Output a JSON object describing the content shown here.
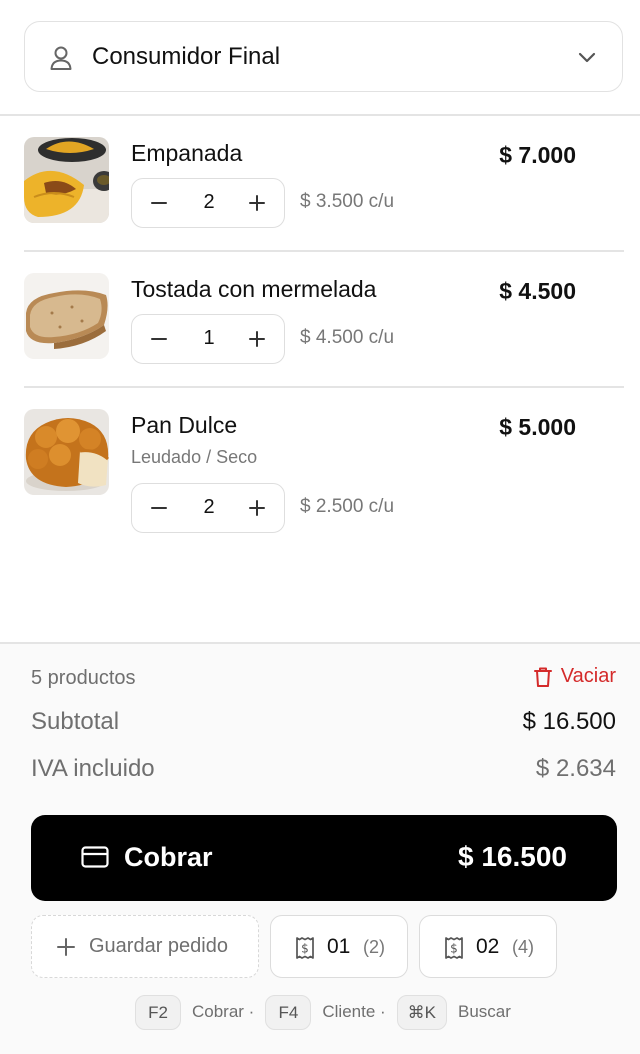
{
  "customer": {
    "name": "Consumidor Final",
    "user_icon": "user-icon",
    "dropdown_icon": "chevron-down-icon"
  },
  "cart": {
    "items": [
      {
        "name": "Empanada",
        "variant": "",
        "quantity": "2",
        "unit_price": "$ 3.500 c/u",
        "total": "$ 7.000"
      },
      {
        "name": "Tostada con mermelada",
        "variant": "",
        "quantity": "1",
        "unit_price": "$ 4.500 c/u",
        "total": "$ 4.500"
      },
      {
        "name": "Pan Dulce",
        "variant": "Leudado / Seco",
        "quantity": "2",
        "unit_price": "$ 2.500 c/u",
        "total": "$ 5.000"
      }
    ]
  },
  "summary": {
    "count": "5 productos",
    "clear_label": "Vaciar",
    "subtotal_label": "Subtotal",
    "subtotal_value": "$ 16.500",
    "iva_label": "IVA incluido",
    "iva_value": "$ 2.634"
  },
  "charge": {
    "label": "Cobrar",
    "amount": "$ 16.500"
  },
  "save_order": {
    "label": "Guardar pedido"
  },
  "saved_orders": [
    {
      "number": "01",
      "count": "(2)"
    },
    {
      "number": "02",
      "count": "(4)"
    }
  ],
  "shortcuts": [
    {
      "key": "F2",
      "label": "Cobrar ·"
    },
    {
      "key": "F4",
      "label": "Cliente ·"
    },
    {
      "key": "⌘K",
      "label": "Buscar"
    }
  ],
  "colors": {
    "accent": "#000000",
    "danger": "#d42a2a",
    "muted": "#6f6f6f"
  }
}
